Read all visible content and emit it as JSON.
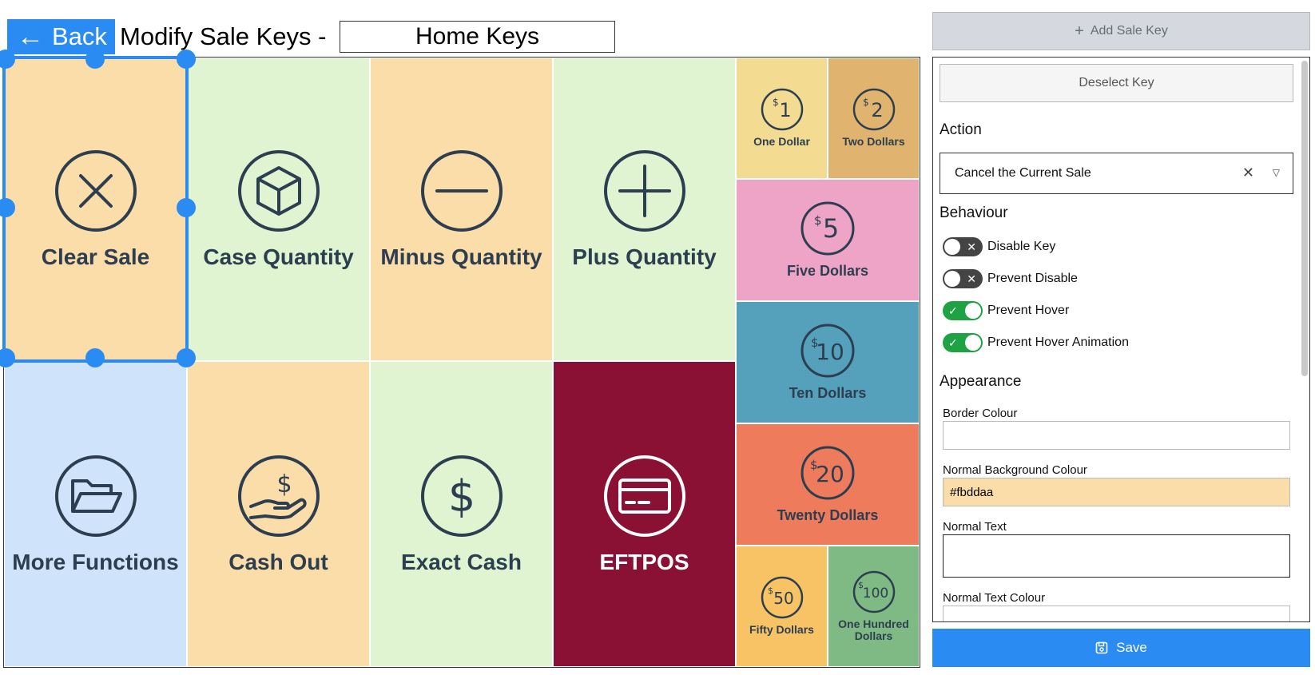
{
  "header": {
    "back_label": "Back",
    "title": "Modify Sale Keys -",
    "keyset_name": "Home Keys"
  },
  "keys": {
    "clear_sale": "Clear Sale",
    "case_quantity": "Case Quantity",
    "minus_quantity": "Minus Quantity",
    "plus_quantity": "Plus Quantity",
    "more_functions": "More Functions",
    "cash_out": "Cash Out",
    "exact_cash": "Exact Cash",
    "eftpos": "EFTPOS",
    "one_dollar": "One Dollar",
    "two_dollars": "Two Dollars",
    "five_dollars": "Five Dollars",
    "ten_dollars": "Ten Dollars",
    "twenty_dollars": "Twenty Dollars",
    "fifty_dollars": "Fifty Dollars",
    "hundred_dollars": "One Hundred Dollars"
  },
  "coin_marks": {
    "one": "1",
    "two": "2",
    "five": "5",
    "ten": "10",
    "twenty": "20",
    "fifty": "50",
    "hundred": "100",
    "dollar": "$"
  },
  "colors": {
    "accent": "#2a8bf2",
    "peach": "#fbddaa",
    "light_green": "#e0f4d2",
    "light_blue": "#cfe3fb",
    "eftpos_red": "#8a1034",
    "one_dollar": "#f3db92",
    "two_dollars": "#e0b46e",
    "five_dollars": "#eda4c7",
    "ten_dollars": "#55a0bb",
    "twenty_dollars": "#ef7b5d",
    "fifty_dollars": "#f8c365",
    "hundred_dollars": "#7fba84",
    "toggle_on": "#1fa244",
    "toggle_off": "#444444"
  },
  "panel": {
    "add_key_label": "Add Sale Key",
    "deselect_label": "Deselect Key",
    "action_heading": "Action",
    "action_value": "Cancel the Current Sale",
    "behaviour_heading": "Behaviour",
    "toggles": [
      {
        "label": "Disable Key",
        "on": false
      },
      {
        "label": "Prevent Disable",
        "on": false
      },
      {
        "label": "Prevent Hover",
        "on": true
      },
      {
        "label": "Prevent Hover Animation",
        "on": true
      }
    ],
    "appearance_heading": "Appearance",
    "border_colour_label": "Border Colour",
    "border_colour_value": "",
    "normal_bg_label": "Normal Background Colour",
    "normal_bg_value": "#fbddaa",
    "normal_text_label": "Normal Text",
    "normal_text_value": "",
    "normal_text_colour_label": "Normal Text Colour",
    "save_label": "Save"
  }
}
